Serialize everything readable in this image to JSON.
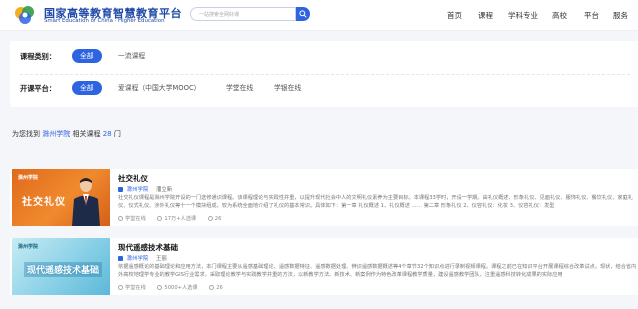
{
  "header": {
    "logo_cn": "国家高等教育智慧教育平台",
    "logo_en": "Smart Education of China · Higher Education",
    "search_placeholder": "一站搜索全网好课",
    "nav": [
      "首页",
      "课程",
      "学科专业",
      "高校",
      "平台",
      "服务"
    ]
  },
  "filters": {
    "category": {
      "label": "课程类别：",
      "options": [
        "全部",
        "一流课程"
      ],
      "active_index": 0
    },
    "platform": {
      "label": "开课平台：",
      "options": [
        "全部",
        "爱课程（中国大学MOOC）",
        "学堂在线",
        "学银在线"
      ],
      "active_index": 0
    }
  },
  "results": {
    "prefix": "为您找到",
    "school": "滁州学院",
    "middle": "相关课程",
    "count": "28",
    "suffix": "门"
  },
  "courses": [
    {
      "thumb_logo": "滁州学院",
      "thumb_title": "社交礼仪",
      "title": "社交礼仪",
      "school": "滁州学院",
      "teacher": "潘立新",
      "description": "社交礼仪课程是滁州学院开设的一门选修通识课程。该课程理论与实践性并重，以提升现代社会中人的文明礼仪素养为主要目标。本课程33学时，开设一学期。由礼仪概述、形象礼仪、见面礼仪、服饰礼仪、餐饮礼仪、家庭礼仪、仪式礼仪、涉外礼仪等十一个模块组成，较为系统全面地介绍了礼仪的基本常识。具体如下：第一章 礼仪概述 1、礼仪概述 …… 第二章 形象礼仪 2、仪容礼仪：化妆 3、仪容礼仪：发型",
      "platform": "学堂在线",
      "learners": "17万+人选课",
      "likes": "26"
    },
    {
      "thumb_logo": "滁州学院",
      "thumb_title": "现代遥感技术基础",
      "title": "现代遥感技术基础",
      "school": "滁州学院",
      "teacher": "王丽",
      "description": "依据遥感概论的基础理论和应用方法，本门课程主要从遥感基础理论、遥感数据特征、遥感数据处理、辨识遥感数据概述等4个章节32个知识点进行录制视频课程。课程之前已在知识平台开展课程综合改革试点。现状，结合省内外高校地理学专业的教学GIS行业需求，采取理论教学与实践教学并重的方法，以新教学方法、新技术、新案例作为特色改革课程教学质量，建设遥感教学团队，注重遥感科技转化成果的实际应用",
      "platform": "学堂在线",
      "learners": "5000+人选课",
      "likes": "26"
    }
  ],
  "colors": {
    "accent": "#2f64e0",
    "thumb1": "#e8741f",
    "thumb2": "#8fd3e8"
  }
}
